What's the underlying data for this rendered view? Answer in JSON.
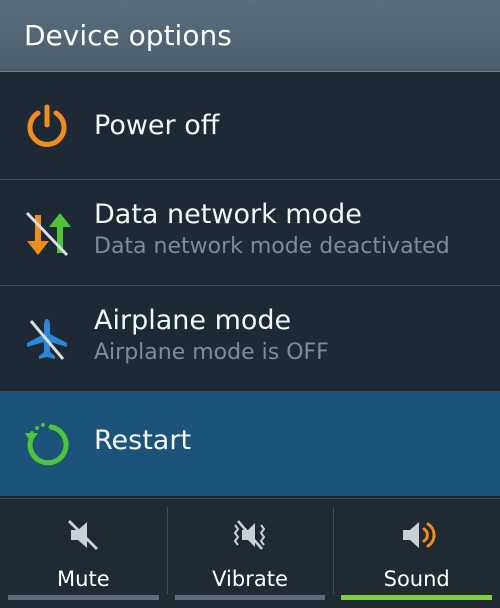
{
  "header": {
    "title": "Device options"
  },
  "options": [
    {
      "title": "Power off",
      "icon": "power-icon"
    },
    {
      "title": "Data network mode",
      "subtitle": "Data network mode deactivated",
      "icon": "data-network-icon"
    },
    {
      "title": "Airplane mode",
      "subtitle": "Airplane mode is OFF",
      "icon": "airplane-icon"
    },
    {
      "title": "Restart",
      "icon": "restart-icon",
      "selected": true
    }
  ],
  "sound_modes": [
    {
      "label": "Mute",
      "icon": "mute-icon"
    },
    {
      "label": "Vibrate",
      "icon": "vibrate-icon"
    },
    {
      "label": "Sound",
      "icon": "sound-icon",
      "active": true
    }
  ],
  "colors": {
    "header": "#4f6372",
    "background": "#1d2934",
    "selected": "#1c5479",
    "power_icon": "#f28c1c",
    "restart_icon": "#4fc43a",
    "airplane_icon": "#2d86d6",
    "active_indicator": "#7fd13b"
  }
}
